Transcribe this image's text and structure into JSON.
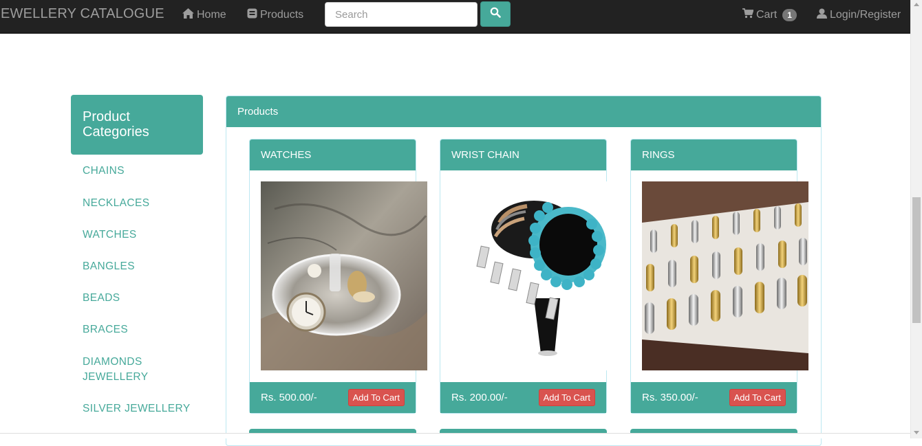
{
  "navbar": {
    "brand": "EWELLERY CATALOGUE",
    "home": "Home",
    "products": "Products",
    "search_placeholder": "Search",
    "cart": "Cart",
    "cart_count": "1",
    "login": "Login/Register"
  },
  "sidebar": {
    "title": "Product Categories",
    "items": [
      "CHAINS",
      "NECKLACES",
      "WATCHES",
      "BANGLES",
      "BEADS",
      "BRACES",
      "DIAMONDS JEWELLERY",
      "SILVER JEWELLERY"
    ]
  },
  "panel": {
    "title": "Products"
  },
  "products": [
    {
      "name": "WATCHES",
      "price": "Rs. 500.00/-",
      "button": "Add To Cart"
    },
    {
      "name": "WRIST CHAIN",
      "price": "Rs. 200.00/-",
      "button": "Add To Cart"
    },
    {
      "name": "RINGS",
      "price": "Rs. 350.00/-",
      "button": "Add To Cart"
    }
  ],
  "colors": {
    "accent": "#46a99a",
    "navbar": "#222222",
    "danger": "#d9534f"
  },
  "icons": {
    "home": "home-icon",
    "products": "list-icon",
    "search": "search-icon",
    "cart": "cart-icon",
    "user": "user-icon"
  }
}
